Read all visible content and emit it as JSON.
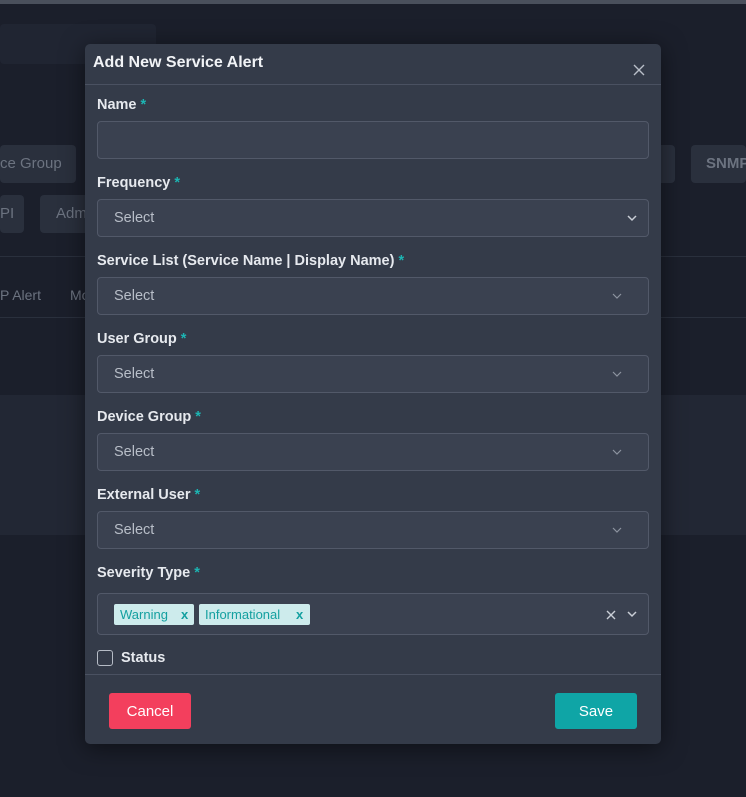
{
  "backdrop": {
    "chips": [
      "ce Group",
      "SNMP",
      "PI",
      "Adm"
    ],
    "tabs": [
      "P Alert",
      "Mo"
    ]
  },
  "modal": {
    "title": "Add New Service Alert",
    "fields": {
      "name": {
        "label": "Name",
        "required": "*",
        "value": ""
      },
      "frequency": {
        "label": "Frequency",
        "required": "*",
        "value": "Select"
      },
      "service_list": {
        "label": "Service List (Service Name | Display Name)",
        "required": "*",
        "value": "Select"
      },
      "user_group": {
        "label": "User Group",
        "required": "*",
        "value": "Select"
      },
      "device_group": {
        "label": "Device Group",
        "required": "*",
        "value": "Select"
      },
      "external_user": {
        "label": "External User",
        "required": "*",
        "value": "Select"
      },
      "severity_type": {
        "label": "Severity Type",
        "required": "*",
        "tags": [
          {
            "label": "Warning",
            "remove": "x"
          },
          {
            "label": "Informational",
            "remove": "x"
          }
        ]
      }
    },
    "status": {
      "label": "Status",
      "checked": false
    },
    "buttons": {
      "cancel": "Cancel",
      "save": "Save"
    }
  },
  "colors": {
    "accent": "#0fa5a6",
    "danger": "#f33f5d",
    "required": "#1cb5b3",
    "modal_bg": "#343b49",
    "backdrop_bg": "#1b1f2b"
  },
  "icons": {
    "close": "close-icon",
    "dropdown": "chevron-down-icon",
    "clear": "clear-x-icon"
  }
}
